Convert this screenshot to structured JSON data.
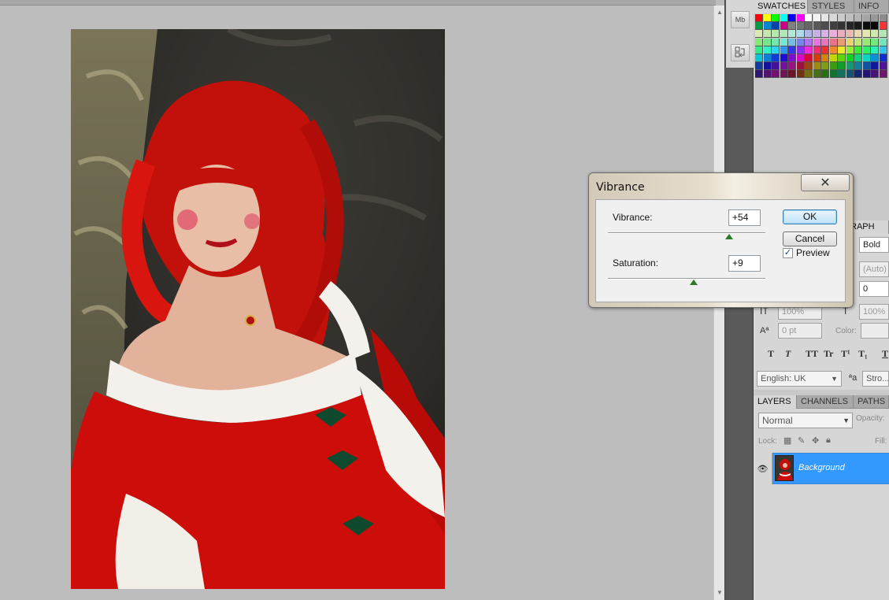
{
  "panels": {
    "top_tabs": [
      "SWATCHES",
      "STYLES",
      "INFO"
    ],
    "char_tab_partial": "RAPH",
    "layers_tabs": [
      "LAYERS",
      "CHANNELS",
      "PATHS"
    ]
  },
  "dock": {
    "button1": "Mb"
  },
  "character": {
    "font_style": "Bold",
    "leading": "(Auto)",
    "tracking": "0",
    "vertical_scale": "100%",
    "horizontal_scale": "100%",
    "baseline_shift": "0 pt",
    "color_label": "Color:",
    "type_buttons": [
      "T",
      "T",
      "TT",
      "Tr",
      "T¹",
      "T₁",
      "T"
    ],
    "language": "English: UK",
    "antialias_icon_text": "ªa",
    "antialias": "Stro..."
  },
  "layers": {
    "blend_mode": "Normal",
    "opacity_label": "Opacity:",
    "lock_label": "Lock:",
    "fill_label": "Fill:",
    "layer_name": "Background"
  },
  "dialog": {
    "title": "Vibrance",
    "vibrance_label": "Vibrance:",
    "vibrance_value": "+54",
    "saturation_label": "Saturation:",
    "saturation_value": "+9",
    "ok": "OK",
    "cancel": "Cancel",
    "preview_label": "Preview",
    "preview_checked": true
  },
  "slider_levels": {
    "vibrance": 54,
    "saturation": 9
  },
  "colors": {
    "accent": "#3399ff",
    "layer_selected": "#3399ff",
    "canvas_bg": "#bdbdbd"
  }
}
